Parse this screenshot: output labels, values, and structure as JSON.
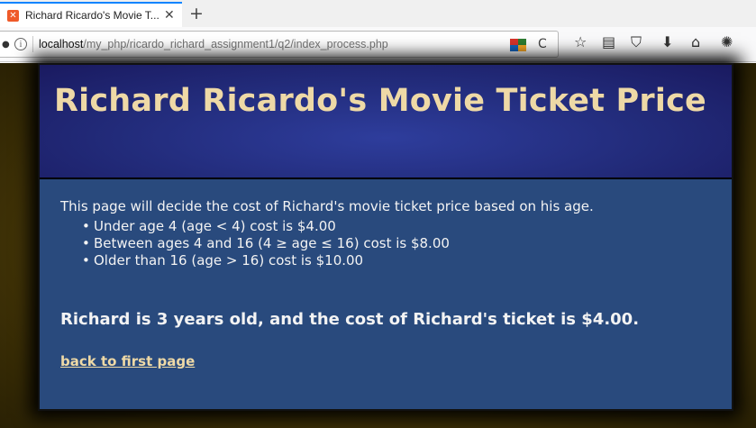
{
  "browser": {
    "tab": {
      "title": "Richard Ricardo's Movie T...",
      "favicon_glyph": "✕",
      "close_glyph": "✕",
      "favicon_color": "#ef5a29"
    },
    "new_tab_glyph": "+",
    "url": {
      "host": "localhost",
      "path": "/my_php/ricardo_richard_assignment1/q2/index_process.php"
    },
    "info_glyph": "i",
    "reload_glyph": "C",
    "toolbar_glyphs": {
      "bookmark": "☆",
      "reader": "▤",
      "pocket": "⛉",
      "download": "⬇",
      "home": "⌂",
      "extension": "✺"
    }
  },
  "page": {
    "title": "Richard Ricardo's Movie Ticket Price",
    "intro": "This page will decide the cost of Richard's movie ticket price based on his age.",
    "rules": [
      "Under age 4 (age < 4) cost is $4.00",
      "Between ages 4 and 16 (4 ≥ age ≤ 16) cost is $8.00",
      "Older than 16 (age > 16) cost is $10.00"
    ],
    "result": "Richard is 3 years old, and the cost of Richard's ticket is $4.00.",
    "back_link": "back to first page",
    "colors": {
      "title": "#eed9a6",
      "panel": "#294a7d",
      "header": "#222b7a",
      "outer_bg": "#3d3006"
    }
  }
}
